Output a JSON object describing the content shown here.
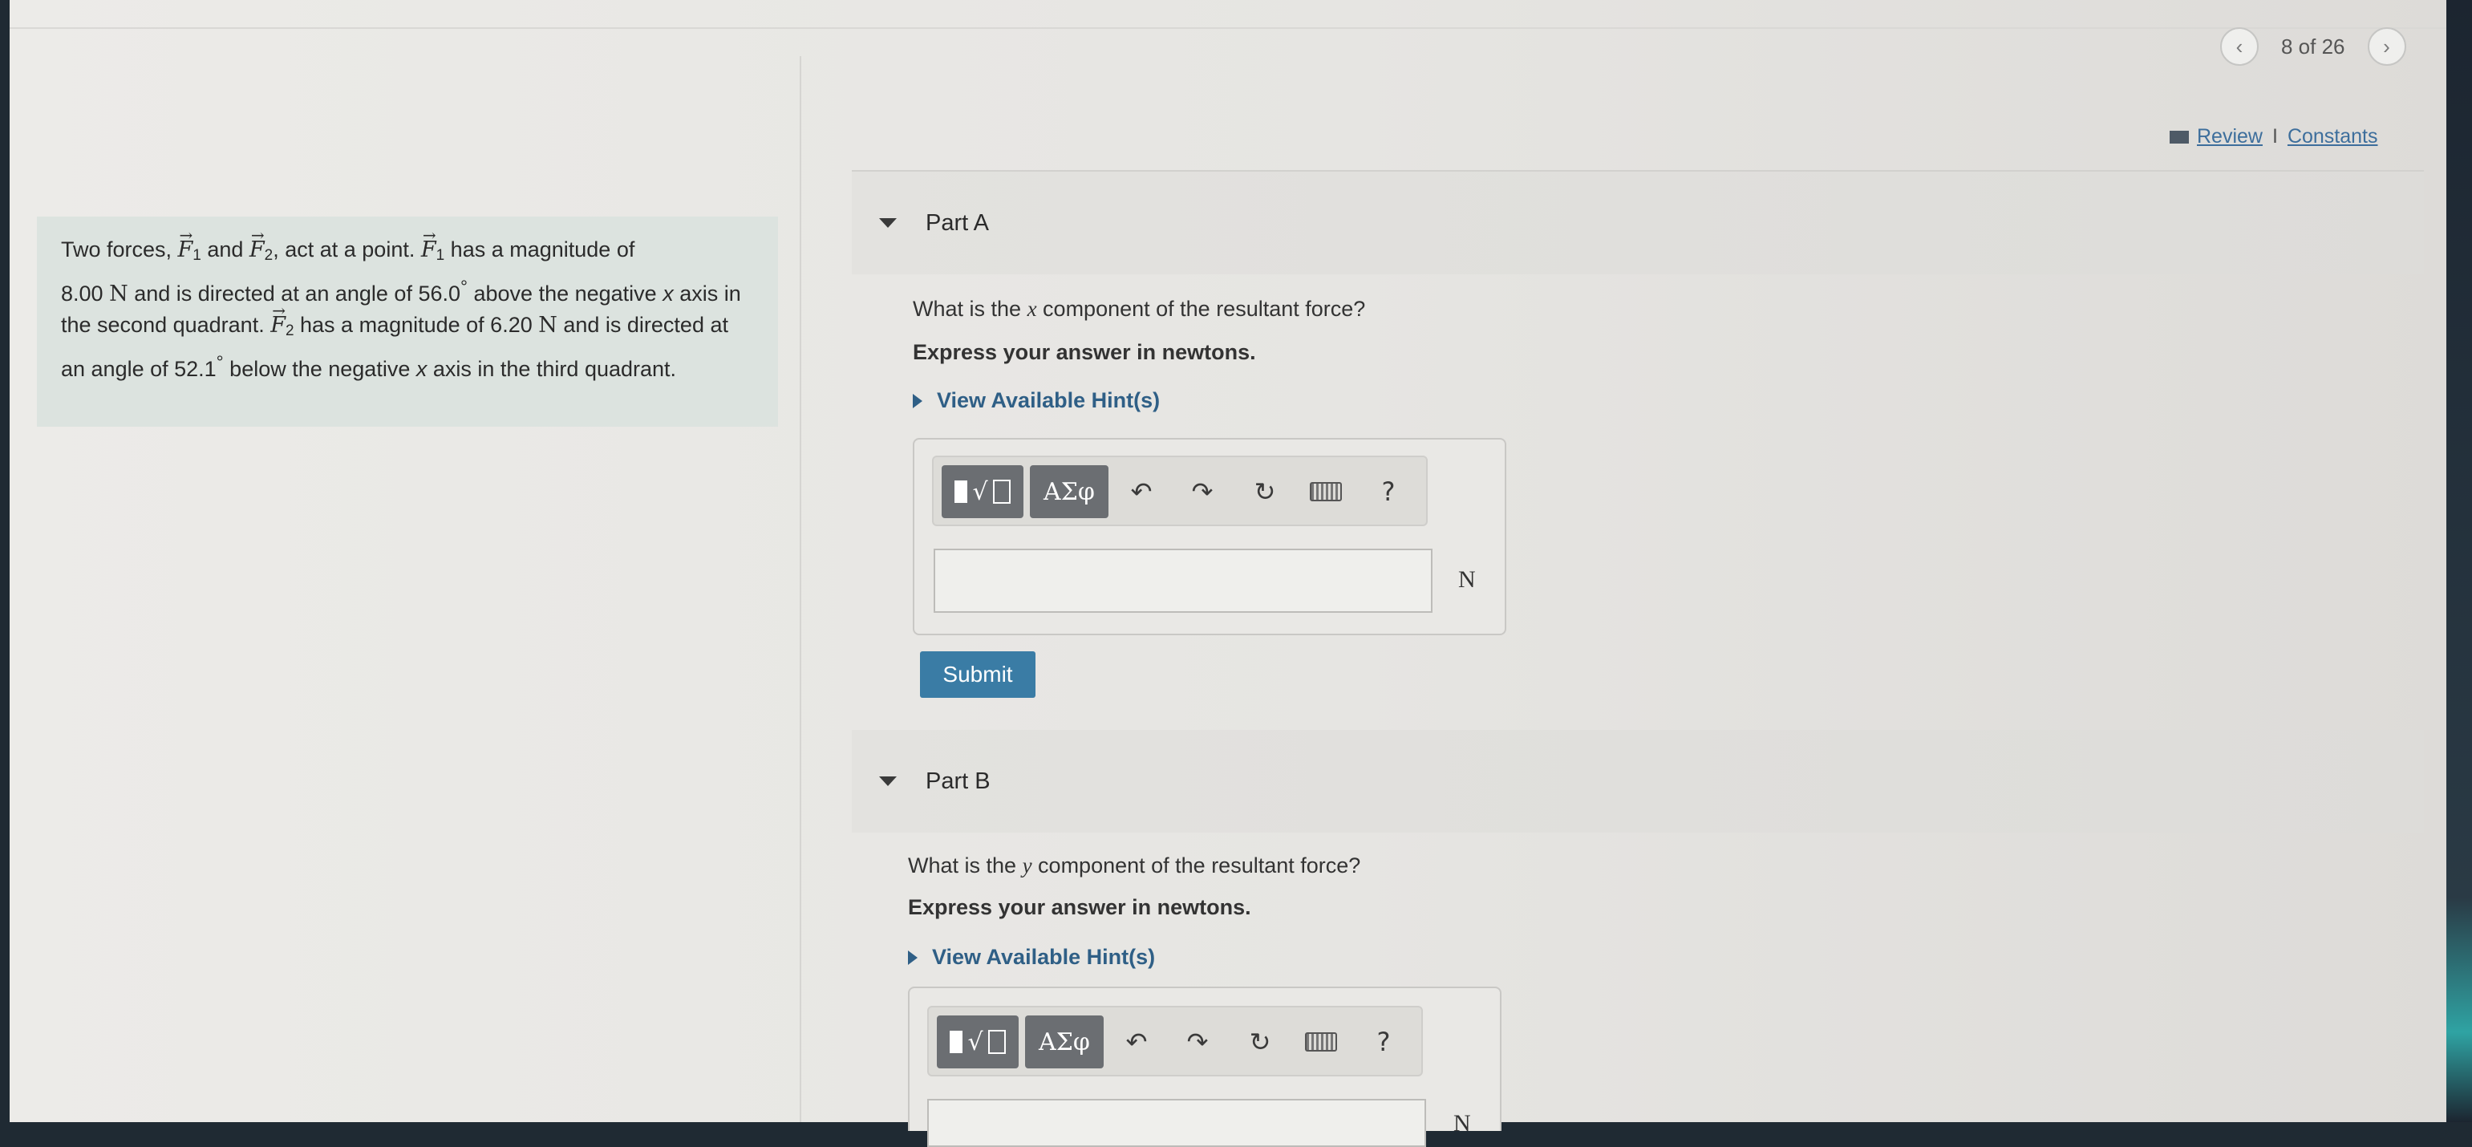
{
  "pager": {
    "label": "8 of 26"
  },
  "links": {
    "review": "Review",
    "separator": "I",
    "constants": "Constants"
  },
  "problem": {
    "t1": "Two forces, ",
    "f": "F",
    "s1": "1",
    "t2": " and ",
    "s2": "2",
    "t3": ", act at a point. ",
    "t4": " has a magnitude of ",
    "mag1": "8.00",
    "unitN": "N",
    "t5": " and is directed at an angle of 56.0",
    "deg": "°",
    "t6": " above the negative ",
    "x": "x",
    "t7": " axis in the second quadrant. ",
    "t8": " has a magnitude of 6.20 ",
    "t9": " and is directed at an angle of 52.1",
    "t10": " below the negative ",
    "t11": " axis in the third quadrant."
  },
  "partA": {
    "title": "Part A",
    "q1": "What is the ",
    "qvar": "x",
    "q2": " component of the resultant force?",
    "instruction": "Express your answer in newtons.",
    "hint": "View Available Hint(s)",
    "unit": "N",
    "submit": "Submit"
  },
  "partB": {
    "title": "Part B",
    "q1": "What is the ",
    "qvar": "y",
    "q2": " component of the resultant force?",
    "instruction": "Express your answer in newtons.",
    "hint": "View Available Hint(s)",
    "unit": "N"
  },
  "toolbar": {
    "greek": "ΑΣφ",
    "undo": "↶",
    "redo": "↷",
    "reset": "↻",
    "help": "?"
  },
  "icons": [
    "chevron-left-icon",
    "chevron-right-icon",
    "book-icon",
    "templates-icon",
    "undo-icon",
    "redo-icon",
    "reset-icon",
    "keyboard-icon",
    "help-icon",
    "caret-down-icon",
    "caret-right-icon"
  ]
}
